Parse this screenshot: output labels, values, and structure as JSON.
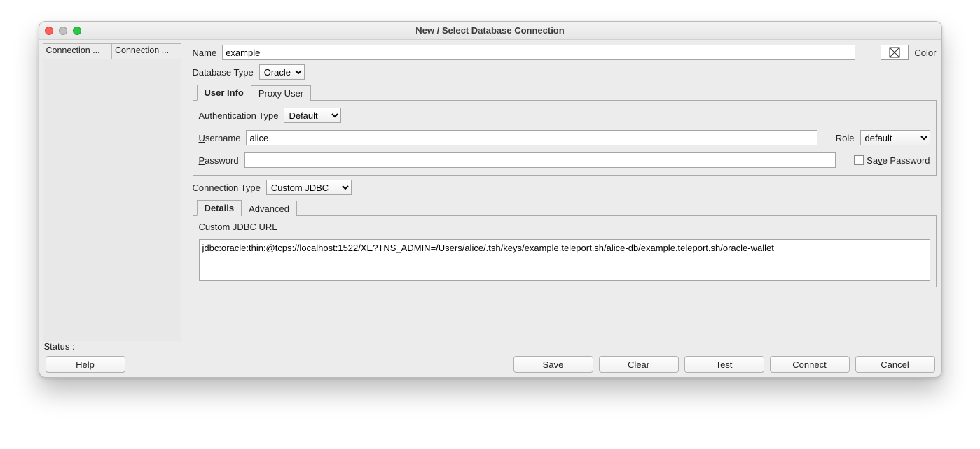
{
  "window": {
    "title": "New / Select Database Connection"
  },
  "sidebar": {
    "columns": [
      "Connection ...",
      "Connection ..."
    ]
  },
  "fields": {
    "name_label": "Name",
    "name_value": "example",
    "color_label": "Color",
    "dbtype_label": "Database Type",
    "dbtype_value": "Oracle"
  },
  "tabs1": {
    "user_info": "User Info",
    "proxy_user": "Proxy User"
  },
  "auth": {
    "type_label": "Authentication Type",
    "type_value": "Default",
    "username_label": "Username",
    "username_u": "U",
    "username_rest": "sername",
    "username_value": "alice",
    "role_label": "Role",
    "role_value": "default",
    "password_label": "Password",
    "password_u": "P",
    "password_rest": "assword",
    "password_value": "",
    "save_pw_label": "Save Password",
    "save_pw_u": "v",
    "save_pw_pre": "Sa",
    "save_pw_post": "e Password"
  },
  "conn": {
    "type_label": "Connection Type",
    "type_value": "Custom JDBC"
  },
  "tabs2": {
    "details": "Details",
    "advanced": "Advanced"
  },
  "jdbc": {
    "url_label_pre": "Custom JDBC ",
    "url_label_u": "U",
    "url_label_post": "RL",
    "url_value": "jdbc:oracle:thin:@tcps://localhost:1522/XE?TNS_ADMIN=/Users/alice/.tsh/keys/example.teleport.sh/alice-db/example.teleport.sh/oracle-wallet"
  },
  "status": {
    "label": "Status :"
  },
  "buttons": {
    "help": "Help",
    "help_u": "H",
    "help_rest": "elp",
    "save": "Save",
    "save_u": "S",
    "save_rest": "ave",
    "clear": "Clear",
    "clear_u": "C",
    "clear_rest": "lear",
    "test": "Test",
    "test_u": "T",
    "test_rest": "est",
    "connect": "Connect",
    "connect_pre": "Co",
    "connect_u": "n",
    "connect_post": "nect",
    "cancel": "Cancel"
  }
}
